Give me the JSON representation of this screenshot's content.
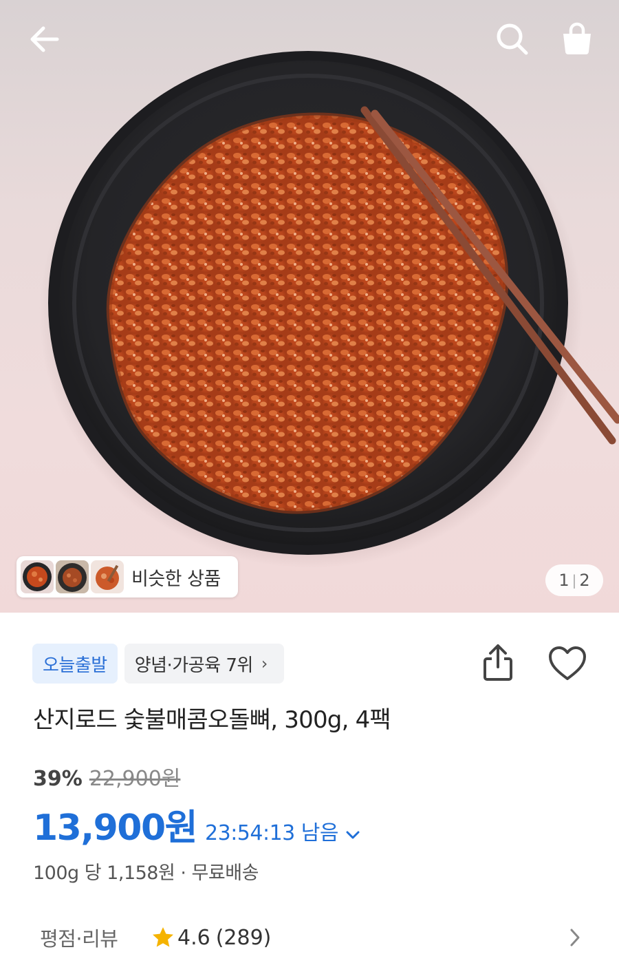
{
  "similar": {
    "label": "비슷한 상품"
  },
  "pager": {
    "current": "1",
    "total": "2"
  },
  "badges": {
    "today": "오늘출발",
    "rank": "양념·가공육 7위",
    "rank_chevron": "›"
  },
  "product": {
    "title": "산지로드 숯불매콤오돌뼈, 300g, 4팩"
  },
  "price": {
    "discount_rate": "39%",
    "original": "22,900원",
    "sale": "13,900원",
    "timer": "23:54:13 남음",
    "unit_info": "100g 당 1,158원 · 무료배송"
  },
  "review": {
    "label": "평점·리뷰",
    "rating": "4.6",
    "count": "(289)"
  },
  "icons": {
    "back": "back-arrow-icon",
    "search": "search-icon",
    "cart": "cart-bag-icon",
    "share": "share-icon",
    "heart": "heart-icon",
    "star": "star-icon"
  },
  "colors": {
    "accent": "#1f6fd8",
    "star": "#f5b301",
    "badge_today_bg": "#e6f0fd"
  }
}
